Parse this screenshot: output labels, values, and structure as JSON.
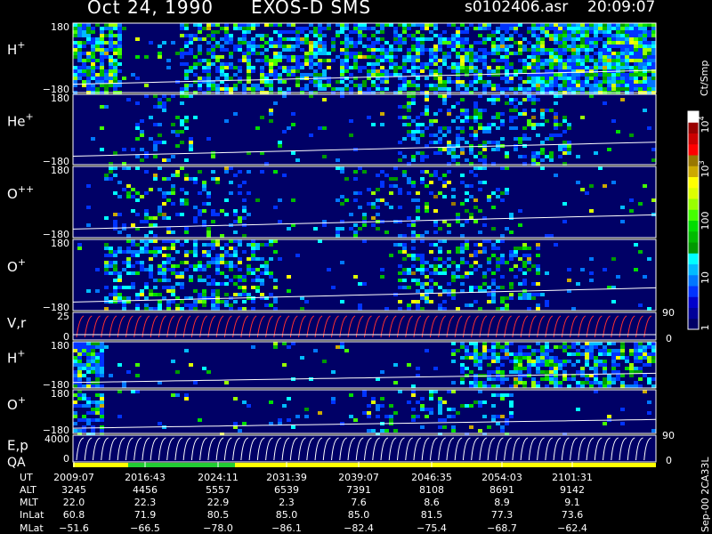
{
  "header": {
    "date": "Oct 24, 1990",
    "instrument": "EXOS-D SMS",
    "filename": "s0102406.asr",
    "time": "20:09:07"
  },
  "panels": [
    {
      "label": "H",
      "sup": "+",
      "top_tick": "180",
      "bottom_tick": "−180"
    },
    {
      "label": "He",
      "sup": "+",
      "top_tick": "180",
      "bottom_tick": "−180"
    },
    {
      "label": "O",
      "sup": "++",
      "top_tick": "180",
      "bottom_tick": "−180"
    },
    {
      "label": "O",
      "sup": "+",
      "top_tick": "180",
      "bottom_tick": "−180"
    },
    {
      "label": "V,r",
      "sup": "",
      "top_tick": "25",
      "bottom_tick": "0",
      "right_top": "90",
      "right_bottom": "0"
    },
    {
      "label": "H",
      "sup": "+",
      "top_tick": "180",
      "bottom_tick": "−180"
    },
    {
      "label": "O",
      "sup": "+",
      "top_tick": "180",
      "bottom_tick": "−180"
    },
    {
      "label": "E,p",
      "sup": "",
      "top_tick": "4000",
      "bottom_tick": "0",
      "right_top": "90",
      "right_bottom": "0"
    }
  ],
  "qa_label": "QA",
  "colorbar": {
    "unit": "Ct/Smp",
    "tick_labels": [
      "1",
      "10",
      "100",
      "10",
      "10"
    ],
    "tick_exponents": [
      "",
      "",
      "",
      "3",
      "4"
    ],
    "colors": [
      "#000066",
      "#000099",
      "#0000cc",
      "#0033ff",
      "#0077ff",
      "#00bbff",
      "#00ffff",
      "#009900",
      "#00bb00",
      "#00dd00",
      "#44ff00",
      "#99ff00",
      "#ddff00",
      "#ffff00",
      "#ccaa00",
      "#997700",
      "#ff0000",
      "#cc0000",
      "#990000",
      "#ffffff"
    ]
  },
  "footer_label": "Sep-00 2CA33L",
  "orbit": {
    "row_labels": [
      "UT",
      "ALT",
      "MLT",
      "InLat",
      "MLat"
    ],
    "columns": [
      {
        "UT": "2009:07",
        "ALT": "3245",
        "MLT": "22.0",
        "InLat": "60.8",
        "MLat": "−51.6"
      },
      {
        "UT": "2016:43",
        "ALT": "4456",
        "MLT": "22.3",
        "InLat": "71.9",
        "MLat": "−66.5"
      },
      {
        "UT": "2024:11",
        "ALT": "5557",
        "MLT": "22.9",
        "InLat": "80.5",
        "MLat": "−78.0"
      },
      {
        "UT": "2031:39",
        "ALT": "6539",
        "MLT": "2.3",
        "InLat": "85.0",
        "MLat": "−86.1"
      },
      {
        "UT": "2039:07",
        "ALT": "7391",
        "MLT": "7.6",
        "InLat": "85.0",
        "MLat": "−82.4"
      },
      {
        "UT": "2046:35",
        "ALT": "8108",
        "MLT": "8.6",
        "InLat": "81.5",
        "MLat": "−75.4"
      },
      {
        "UT": "2054:03",
        "ALT": "8691",
        "MLT": "8.9",
        "InLat": "77.3",
        "MLat": "−68.7"
      },
      {
        "UT": "2101:31",
        "ALT": "9142",
        "MLT": "9.1",
        "InLat": "73.6",
        "MLat": "−62.4"
      }
    ]
  },
  "chart_data": {
    "type": "heatmap",
    "title": "EXOS-D SMS",
    "x_axis": "UT",
    "x_ticks": [
      "2009:07",
      "2016:43",
      "2024:11",
      "2031:39",
      "2039:07",
      "2046:35",
      "2054:03",
      "2101:31"
    ],
    "color_scale": "log",
    "color_range": [
      1,
      10000
    ],
    "panels": [
      "H+",
      "He+",
      "O++",
      "O+",
      "V,r",
      "H+",
      "O+",
      "E,p"
    ]
  }
}
